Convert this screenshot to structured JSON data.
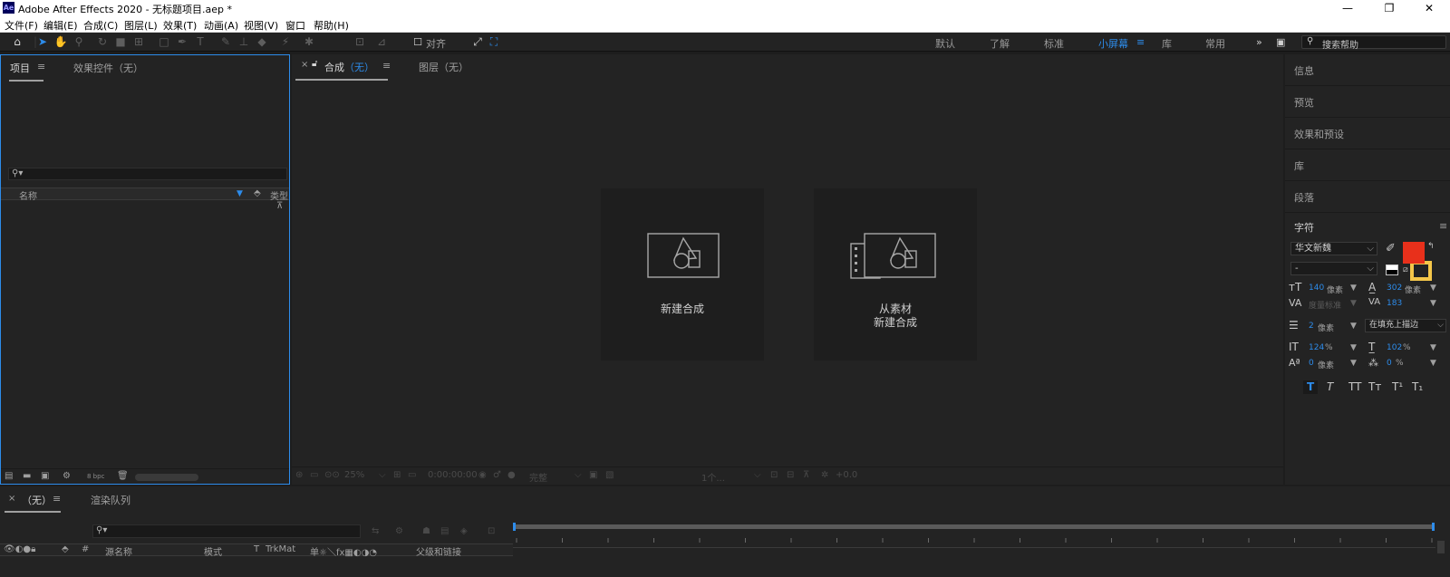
{
  "window": {
    "title": "Adobe After Effects 2020 - 无标题项目.aep *",
    "logo": "Ae",
    "minimize": "—",
    "restore": "❐",
    "close": "✕"
  },
  "menu": [
    "文件(F)",
    "编辑(E)",
    "合成(C)",
    "图层(L)",
    "效果(T)",
    "动画(A)",
    "视图(V)",
    "窗口",
    "帮助(H)"
  ],
  "toolbar": {
    "snap_label": "对齐",
    "workspaces": [
      "默认",
      "了解",
      "标准",
      "小屏幕",
      "库",
      "常用"
    ],
    "active_workspace": "小屏幕",
    "help_placeholder": "搜索帮助"
  },
  "project_panel": {
    "tab_project": "项目",
    "tab_effects": "效果控件（无）",
    "col_name": "名称",
    "col_type": "类型",
    "bpc": "8 bpc"
  },
  "comp_panel": {
    "tab_comp_prefix": "合成",
    "tab_comp_none": "（无）",
    "tab_layer": "图层（无）",
    "card_new_comp": "新建合成",
    "card_from_footage_line1": "从素材",
    "card_from_footage_line2": "新建合成",
    "footer": {
      "zoom": "25%",
      "timecode": "0:00:00:00",
      "quality": "完整",
      "views": "1个...",
      "exposure": "+0.0"
    }
  },
  "right_panel": {
    "items": [
      "信息",
      "预览",
      "效果和预设",
      "库",
      "段落"
    ],
    "character_title": "字符",
    "font_family": "华文新魏",
    "font_style": "-",
    "font_size_value": "140",
    "font_size_unit": "像素",
    "leading_value": "302",
    "leading_unit": "像素",
    "kerning": "度量标准",
    "tracking": "183",
    "stroke_width_value": "2",
    "stroke_width_unit": "像素",
    "stroke_mode": "在填充上描边",
    "vscale_value": "124",
    "vscale_unit": "%",
    "hscale_value": "102",
    "hscale_unit": "%",
    "baseline_value": "0",
    "baseline_unit": "像素",
    "tsume_value": "0",
    "tsume_unit": "%",
    "style_buttons": [
      "T",
      "T",
      "TT",
      "Tт",
      "T¹",
      "T₁"
    ],
    "fill_color": "#e8301b",
    "stroke_color": "#f5c74a"
  },
  "timeline": {
    "tab_comp": "（无）",
    "tab_render": "渲染队列",
    "col_source": "源名称",
    "col_mode": "模式",
    "col_t": "T",
    "col_trkmat": "TrkMat",
    "col_switches": "单☼＼fx▦◐◑◔",
    "col_parent": "父级和链接",
    "col_hash": "#"
  },
  "colors": {
    "accent": "#2d8ceb",
    "panel_bg": "#232323",
    "frame_bg": "#1d1d1d"
  }
}
